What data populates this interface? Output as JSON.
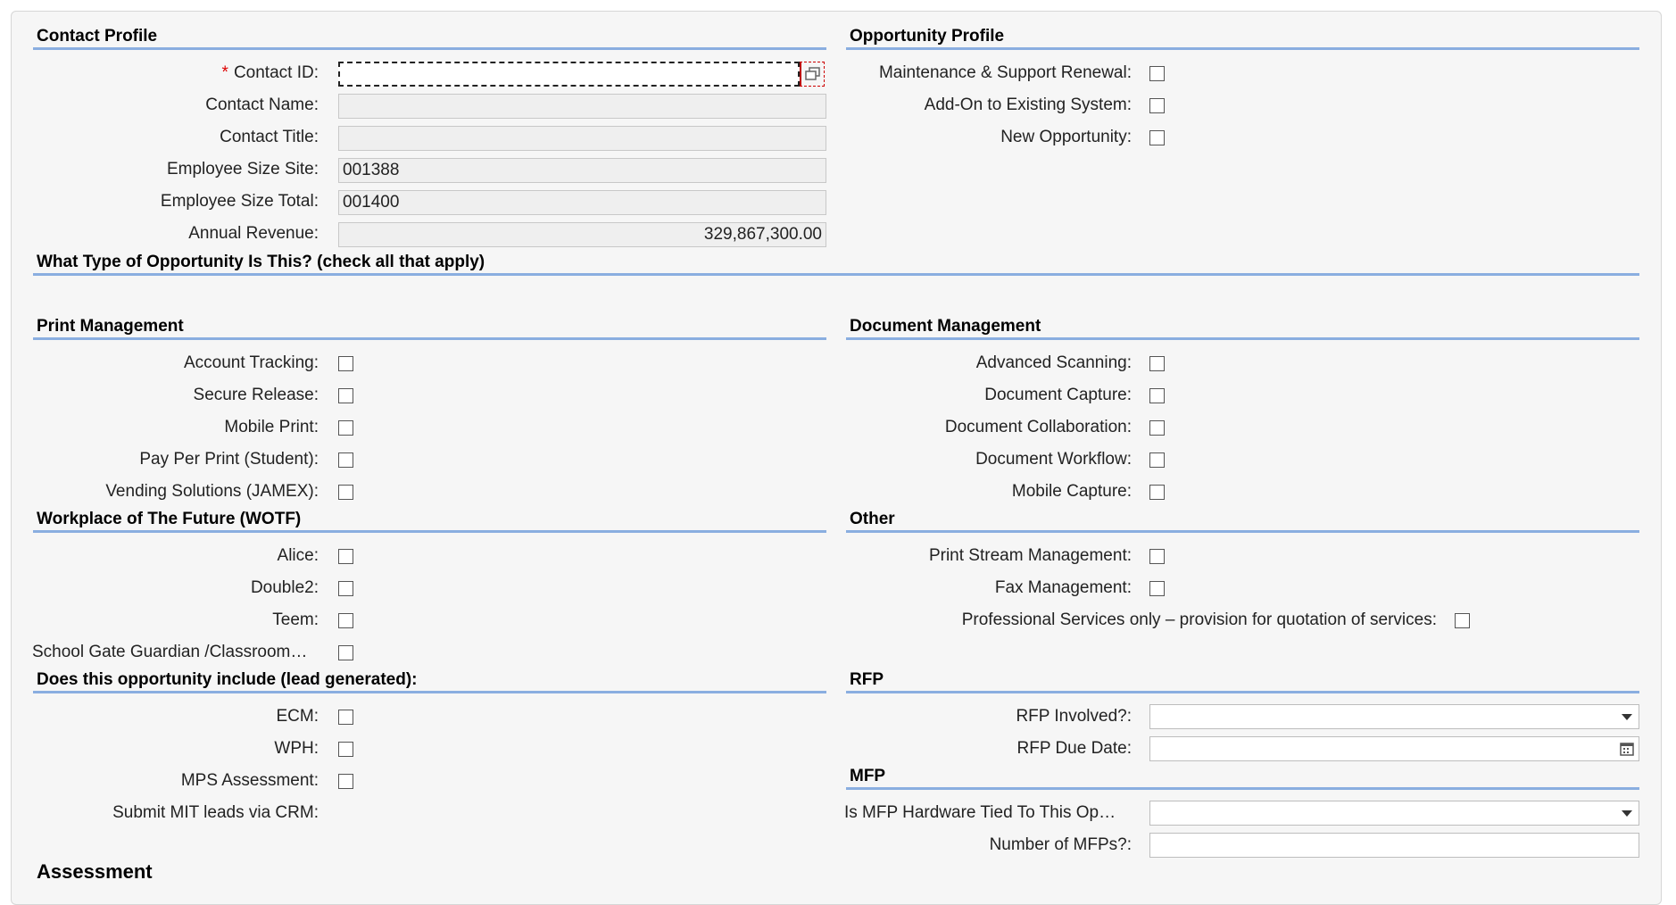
{
  "contact_profile": {
    "title": "Contact Profile",
    "required_mark": "*",
    "contact_id_label": "Contact ID:",
    "contact_id_value": "",
    "contact_name_label": "Contact Name:",
    "contact_name_value": "",
    "contact_title_label": "Contact Title:",
    "contact_title_value": "",
    "employee_size_site_label": "Employee Size Site:",
    "employee_size_site_value": "001388",
    "employee_size_total_label": "Employee Size Total:",
    "employee_size_total_value": "001400",
    "annual_revenue_label": "Annual Revenue:",
    "annual_revenue_value": "329,867,300.00"
  },
  "opportunity_profile": {
    "title": "Opportunity Profile",
    "maintenance_label": "Maintenance & Support Renewal:",
    "addon_label": "Add-On to Existing System:",
    "new_label": "New Opportunity:"
  },
  "opportunity_type": {
    "title": "What Type of Opportunity Is This? (check all that apply)"
  },
  "print_management": {
    "title": "Print Management",
    "items": [
      "Account Tracking:",
      "Secure Release:",
      "Mobile Print:",
      "Pay Per Print (Student):",
      "Vending Solutions (JAMEX):"
    ]
  },
  "document_management": {
    "title": "Document Management",
    "items": [
      "Advanced Scanning:",
      "Document Capture:",
      "Document Collaboration:",
      "Document Workflow:",
      "Mobile Capture:"
    ]
  },
  "wotf": {
    "title": "Workplace of The Future (WOTF)",
    "items": [
      "Alice:",
      "Double2:",
      "Teem:",
      "School Gate Guardian /Classroom…"
    ]
  },
  "other": {
    "title": "Other",
    "items": [
      "Print Stream Management:",
      "Fax Management:",
      "Professional Services only – provision for quotation of services:"
    ]
  },
  "lead_generated": {
    "title": "Does this opportunity include (lead generated):",
    "items": [
      "ECM:",
      "WPH:",
      "MPS Assessment:"
    ],
    "submit_label": "Submit MIT leads via CRM:"
  },
  "rfp": {
    "title": "RFP",
    "involved_label": "RFP Involved?:",
    "involved_value": "",
    "due_date_label": "RFP Due Date:",
    "due_date_value": ""
  },
  "mfp": {
    "title": "MFP",
    "tied_label": "Is MFP Hardware Tied To This Op…",
    "tied_value": "",
    "number_label": "Number of MFPs?:",
    "number_value": ""
  },
  "next_section_partial": "Assessment"
}
